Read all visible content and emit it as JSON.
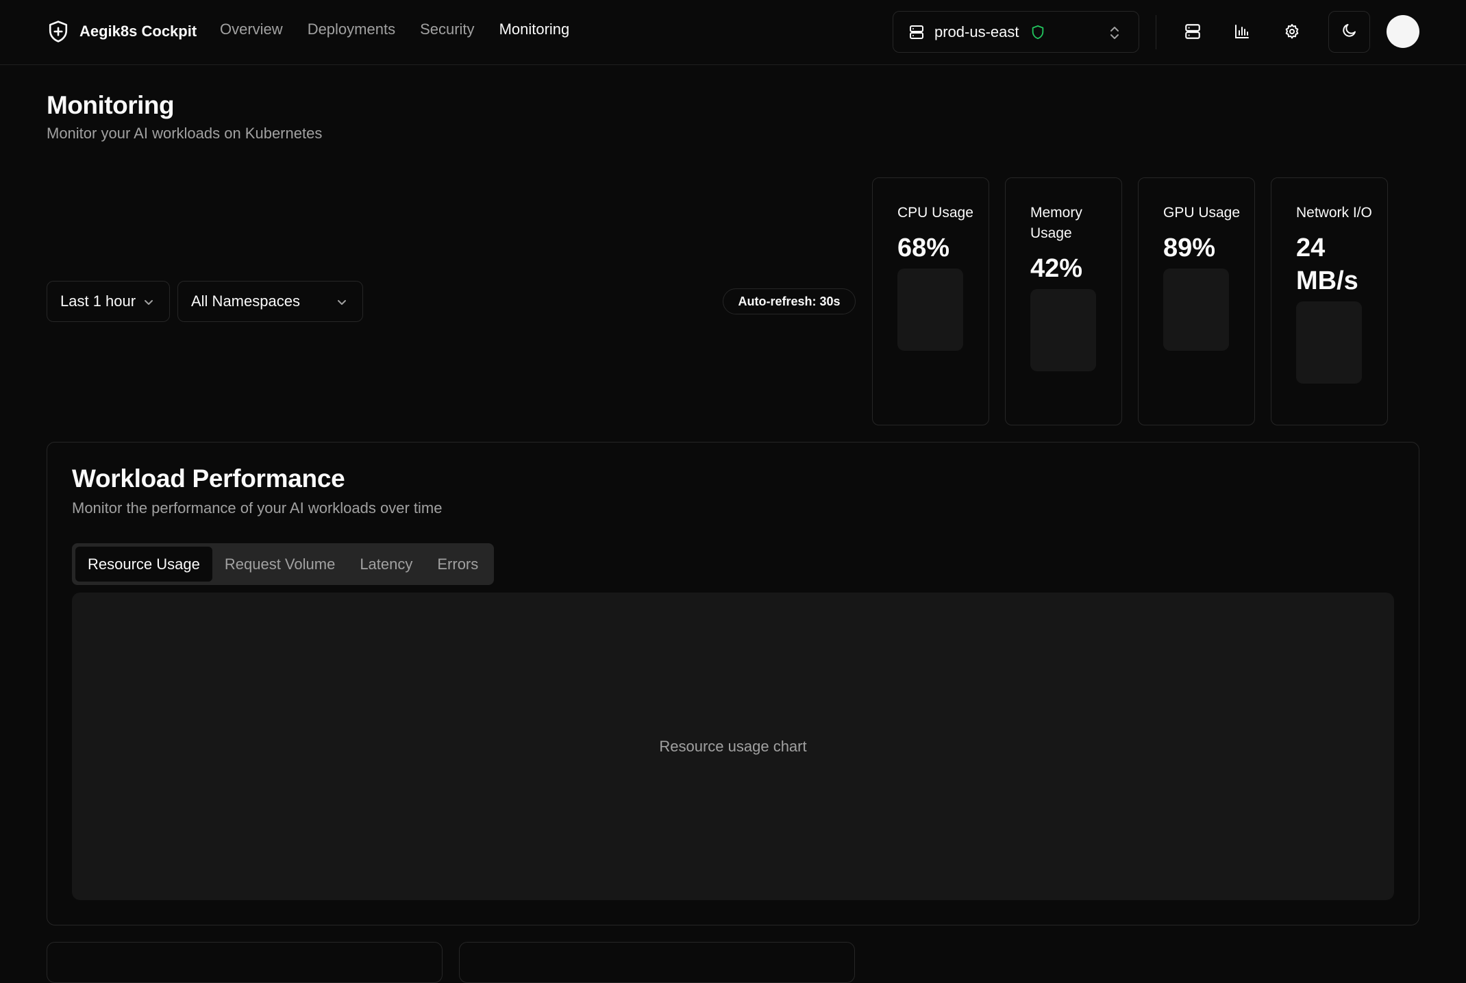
{
  "app": {
    "name": "Aegik8s Cockpit"
  },
  "nav": {
    "items": [
      {
        "label": "Overview",
        "active": false
      },
      {
        "label": "Deployments",
        "active": false
      },
      {
        "label": "Security",
        "active": false
      },
      {
        "label": "Monitoring",
        "active": true
      }
    ]
  },
  "cluster": {
    "name": "prod-us-east",
    "status_color": "#22c55e"
  },
  "header_icons": [
    "server-icon",
    "bar-chart-icon",
    "gear-icon",
    "moon-icon"
  ],
  "page": {
    "title": "Monitoring",
    "subtitle": "Monitor your AI workloads on Kubernetes"
  },
  "filters": {
    "time_range": "Last 1 hour",
    "namespace": "All Namespaces",
    "auto_refresh": "Auto-refresh: 30s"
  },
  "metrics": [
    {
      "label": "CPU Usage",
      "value": "68%"
    },
    {
      "label": "Memory Usage",
      "value": "42%"
    },
    {
      "label": "GPU Usage",
      "value": "89%"
    },
    {
      "label": "Network I/O",
      "value": "24 MB/s"
    }
  ],
  "workload": {
    "title": "Workload Performance",
    "subtitle": "Monitor the performance of your AI workloads over time",
    "tabs": [
      {
        "label": "Resource Usage",
        "active": true
      },
      {
        "label": "Request Volume",
        "active": false
      },
      {
        "label": "Latency",
        "active": false
      },
      {
        "label": "Errors",
        "active": false
      }
    ],
    "chart_placeholder": "Resource usage chart"
  }
}
